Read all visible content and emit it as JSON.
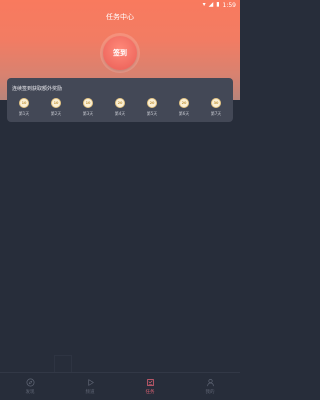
{
  "status_bar": {
    "time": "1:59"
  },
  "header": {
    "title": "任务中心"
  },
  "signin": {
    "label": "签到"
  },
  "card": {
    "title": "连续签到获取额外奖励",
    "days": [
      {
        "coins": "10",
        "label": "第1天"
      },
      {
        "coins": "10",
        "label": "第2天"
      },
      {
        "coins": "10",
        "label": "第3天"
      },
      {
        "coins": "20",
        "label": "第4天"
      },
      {
        "coins": "20",
        "label": "第5天"
      },
      {
        "coins": "20",
        "label": "第6天"
      },
      {
        "coins": "30",
        "label": "第7天"
      }
    ]
  },
  "tabs": [
    {
      "label": "发现",
      "icon": "compass-icon",
      "active": false
    },
    {
      "label": "频道",
      "icon": "play-icon",
      "active": false
    },
    {
      "label": "任务",
      "icon": "task-icon",
      "active": true
    },
    {
      "label": "我的",
      "icon": "user-icon",
      "active": false
    }
  ],
  "colors": {
    "accent": "#e56476",
    "header_top": "#f97a5e",
    "card_bg": "#434856",
    "page_bg": "#272d3a"
  }
}
